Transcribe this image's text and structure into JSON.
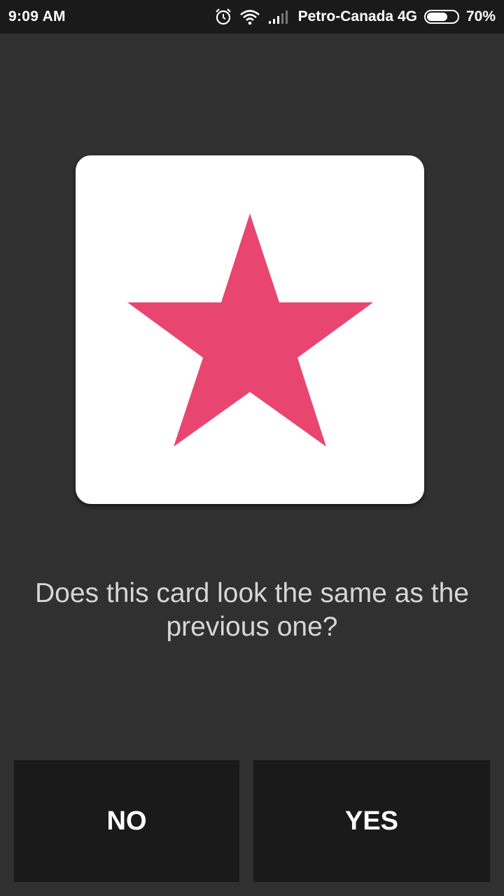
{
  "status_bar": {
    "time": "9:09 AM",
    "carrier": "Petro-Canada 4G",
    "battery_percent": "70%",
    "battery_level": 0.7,
    "icons": [
      "alarm-icon",
      "wifi-icon",
      "signal-icon",
      "battery-icon"
    ]
  },
  "card": {
    "shape": "star-icon",
    "shape_color": "#E84670",
    "background": "#FFFFFF"
  },
  "question": {
    "line1": "Does this card look the same as the",
    "line2": "previous one?"
  },
  "buttons": {
    "no_label": "NO",
    "yes_label": "YES"
  },
  "colors": {
    "background": "#303030",
    "button_bg": "#1A1A1A",
    "status_bar_bg": "#1A1A1A"
  }
}
